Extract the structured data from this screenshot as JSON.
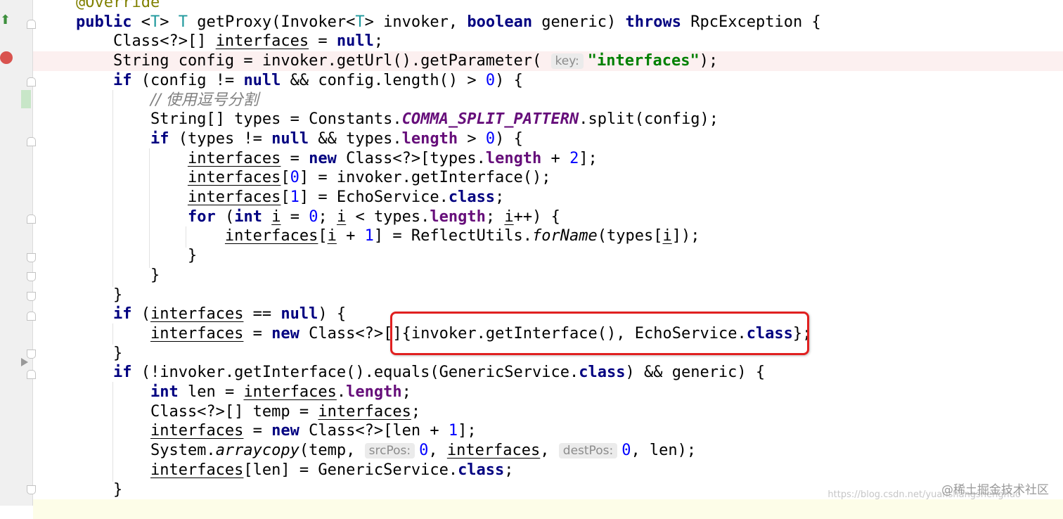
{
  "editor": {
    "lines": [
      {
        "id": "l0",
        "tokens": [
          {
            "t": "@Override",
            "c": "ann"
          }
        ]
      },
      {
        "id": "l1",
        "tokens": [
          {
            "t": "public ",
            "c": "kw"
          },
          {
            "t": "<"
          },
          {
            "t": "T",
            "c": "gen"
          },
          {
            "t": "> "
          },
          {
            "t": "T",
            "c": "gen"
          },
          {
            "t": " getProxy(Invoker<"
          },
          {
            "t": "T",
            "c": "gen"
          },
          {
            "t": "> invoker, "
          },
          {
            "t": "boolean",
            "c": "kw"
          },
          {
            "t": " generic) "
          },
          {
            "t": "throws",
            "c": "kw"
          },
          {
            "t": " RpcException {"
          }
        ]
      },
      {
        "id": "l2",
        "tokens": [
          {
            "t": "    Class<?>[] "
          },
          {
            "t": "interfaces",
            "c": "ul"
          },
          {
            "t": " = "
          },
          {
            "t": "null",
            "c": "kw"
          },
          {
            "t": ";"
          }
        ]
      },
      {
        "id": "l3",
        "tokens": [
          {
            "t": "    String config = invoker.getUrl().getParameter( "
          },
          {
            "t": "key:",
            "c": "hint"
          },
          {
            "t": "\"interfaces\"",
            "c": "str"
          },
          {
            "t": ");"
          }
        ]
      },
      {
        "id": "l4",
        "tokens": [
          {
            "t": "    "
          },
          {
            "t": "if",
            "c": "kw"
          },
          {
            "t": " (config != "
          },
          {
            "t": "null",
            "c": "kw"
          },
          {
            "t": " && config.length() > "
          },
          {
            "t": "0",
            "c": "num"
          },
          {
            "t": ") {"
          }
        ]
      },
      {
        "id": "l5",
        "tokens": [
          {
            "t": "        "
          },
          {
            "t": "// 使用逗号分割",
            "c": "cmt"
          }
        ]
      },
      {
        "id": "l6",
        "tokens": [
          {
            "t": "        String[] types = Constants."
          },
          {
            "t": "COMMA_SPLIT_PATTERN",
            "c": "sfld"
          },
          {
            "t": ".split(config);"
          }
        ]
      },
      {
        "id": "l7",
        "tokens": [
          {
            "t": "        "
          },
          {
            "t": "if",
            "c": "kw"
          },
          {
            "t": " (types != "
          },
          {
            "t": "null",
            "c": "kw"
          },
          {
            "t": " && types."
          },
          {
            "t": "length",
            "c": "fld"
          },
          {
            "t": " > "
          },
          {
            "t": "0",
            "c": "num"
          },
          {
            "t": ") {"
          }
        ]
      },
      {
        "id": "l8",
        "tokens": [
          {
            "t": "            "
          },
          {
            "t": "interfaces",
            "c": "ul"
          },
          {
            "t": " = "
          },
          {
            "t": "new",
            "c": "kw"
          },
          {
            "t": " Class<?>[types."
          },
          {
            "t": "length",
            "c": "fld"
          },
          {
            "t": " + "
          },
          {
            "t": "2",
            "c": "num"
          },
          {
            "t": "];"
          }
        ]
      },
      {
        "id": "l9",
        "tokens": [
          {
            "t": "            "
          },
          {
            "t": "interfaces",
            "c": "ul"
          },
          {
            "t": "["
          },
          {
            "t": "0",
            "c": "num"
          },
          {
            "t": "] = invoker.getInterface();"
          }
        ]
      },
      {
        "id": "l10",
        "tokens": [
          {
            "t": "            "
          },
          {
            "t": "interfaces",
            "c": "ul"
          },
          {
            "t": "["
          },
          {
            "t": "1",
            "c": "num"
          },
          {
            "t": "] = EchoService."
          },
          {
            "t": "class",
            "c": "kw"
          },
          {
            "t": ";"
          }
        ]
      },
      {
        "id": "l11",
        "tokens": [
          {
            "t": "            "
          },
          {
            "t": "for",
            "c": "kw"
          },
          {
            "t": " ("
          },
          {
            "t": "int",
            "c": "kw"
          },
          {
            "t": " "
          },
          {
            "t": "i",
            "c": "ul"
          },
          {
            "t": " = "
          },
          {
            "t": "0",
            "c": "num"
          },
          {
            "t": "; "
          },
          {
            "t": "i",
            "c": "ul"
          },
          {
            "t": " < types."
          },
          {
            "t": "length",
            "c": "fld"
          },
          {
            "t": "; "
          },
          {
            "t": "i",
            "c": "ul"
          },
          {
            "t": "++) {"
          }
        ]
      },
      {
        "id": "l12",
        "tokens": [
          {
            "t": "                "
          },
          {
            "t": "interfaces",
            "c": "ul"
          },
          {
            "t": "["
          },
          {
            "t": "i",
            "c": "ul"
          },
          {
            "t": " + "
          },
          {
            "t": "1",
            "c": "num"
          },
          {
            "t": "] = ReflectUtils."
          },
          {
            "t": "forName",
            "c": "smeth"
          },
          {
            "t": "(types["
          },
          {
            "t": "i",
            "c": "ul"
          },
          {
            "t": "]);"
          }
        ]
      },
      {
        "id": "l13",
        "tokens": [
          {
            "t": "            }"
          }
        ]
      },
      {
        "id": "l14",
        "tokens": [
          {
            "t": "        }"
          }
        ]
      },
      {
        "id": "l15",
        "tokens": [
          {
            "t": "    }"
          }
        ]
      },
      {
        "id": "l16",
        "tokens": [
          {
            "t": "    "
          },
          {
            "t": "if",
            "c": "kw"
          },
          {
            "t": " ("
          },
          {
            "t": "interfaces",
            "c": "ul"
          },
          {
            "t": " == "
          },
          {
            "t": "null",
            "c": "kw"
          },
          {
            "t": ") {"
          }
        ]
      },
      {
        "id": "l17",
        "tokens": [
          {
            "t": "        "
          },
          {
            "t": "interfaces",
            "c": "ul"
          },
          {
            "t": " = "
          },
          {
            "t": "new",
            "c": "kw"
          },
          {
            "t": " Class<?>[]{invoker.getInterface(), EchoService."
          },
          {
            "t": "class",
            "c": "kw"
          },
          {
            "t": "};"
          }
        ]
      },
      {
        "id": "l18",
        "tokens": [
          {
            "t": "    }"
          }
        ]
      },
      {
        "id": "l19",
        "tokens": [
          {
            "t": "    "
          },
          {
            "t": "if",
            "c": "kw"
          },
          {
            "t": " (!invoker.getInterface().equals(GenericService."
          },
          {
            "t": "class",
            "c": "kw"
          },
          {
            "t": ") && generic) {"
          }
        ]
      },
      {
        "id": "l20",
        "tokens": [
          {
            "t": "        "
          },
          {
            "t": "int",
            "c": "kw"
          },
          {
            "t": " len = "
          },
          {
            "t": "interfaces",
            "c": "ul"
          },
          {
            "t": "."
          },
          {
            "t": "length",
            "c": "fld"
          },
          {
            "t": ";"
          }
        ]
      },
      {
        "id": "l21",
        "tokens": [
          {
            "t": "        Class<?>[] temp = "
          },
          {
            "t": "interfaces",
            "c": "ul"
          },
          {
            "t": ";"
          }
        ]
      },
      {
        "id": "l22",
        "tokens": [
          {
            "t": "        "
          },
          {
            "t": "interfaces",
            "c": "ul"
          },
          {
            "t": " = "
          },
          {
            "t": "new",
            "c": "kw"
          },
          {
            "t": " Class<?>[len + "
          },
          {
            "t": "1",
            "c": "num"
          },
          {
            "t": "];"
          }
        ]
      },
      {
        "id": "l23",
        "tokens": [
          {
            "t": "        System."
          },
          {
            "t": "arraycopy",
            "c": "smeth"
          },
          {
            "t": "(temp, "
          },
          {
            "t": "srcPos:",
            "c": "hint"
          },
          {
            "t": "0",
            "c": "num"
          },
          {
            "t": ", "
          },
          {
            "t": "interfaces",
            "c": "ul"
          },
          {
            "t": ", "
          },
          {
            "t": "destPos:",
            "c": "hint"
          },
          {
            "t": "0",
            "c": "num"
          },
          {
            "t": ", len);"
          }
        ]
      },
      {
        "id": "l24",
        "tokens": [
          {
            "t": "        "
          },
          {
            "t": "interfaces",
            "c": "ul"
          },
          {
            "t": "[len] = GenericService."
          },
          {
            "t": "class",
            "c": "kw"
          },
          {
            "t": ";"
          }
        ]
      },
      {
        "id": "l25",
        "tokens": [
          {
            "t": "    }"
          }
        ]
      }
    ]
  },
  "watermark": {
    "text": "@稀土掘金技术社区",
    "url": "https://blog.csdn.net/yuanshangshenghuo"
  }
}
